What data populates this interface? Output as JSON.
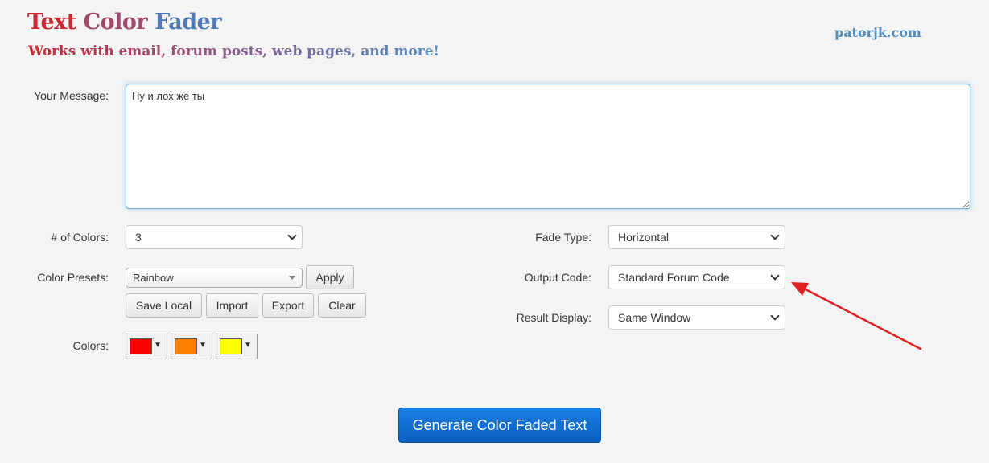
{
  "header": {
    "title_words": [
      "Text",
      "Color",
      "Fader"
    ],
    "subtitle": "Works with email, forum posts, web pages, and more!",
    "site_link": "patorjk.com"
  },
  "message": {
    "label": "Your Message:",
    "value": "Ну и лох же ты"
  },
  "num_colors": {
    "label": "# of Colors:",
    "value": "3"
  },
  "color_presets": {
    "label": "Color Presets:",
    "value": "Rainbow",
    "apply_label": "Apply",
    "save_local_label": "Save Local",
    "import_label": "Import",
    "export_label": "Export",
    "clear_label": "Clear"
  },
  "colors": {
    "label": "Colors:",
    "swatches": [
      "#ff0000",
      "#ff8000",
      "#ffff00"
    ]
  },
  "fade_type": {
    "label": "Fade Type:",
    "value": "Horizontal"
  },
  "output_code": {
    "label": "Output Code:",
    "value": "Standard Forum Code"
  },
  "result_display": {
    "label": "Result Display:",
    "value": "Same Window"
  },
  "generate_label": "Generate Color Faded Text",
  "annotation_color": "#e02020"
}
